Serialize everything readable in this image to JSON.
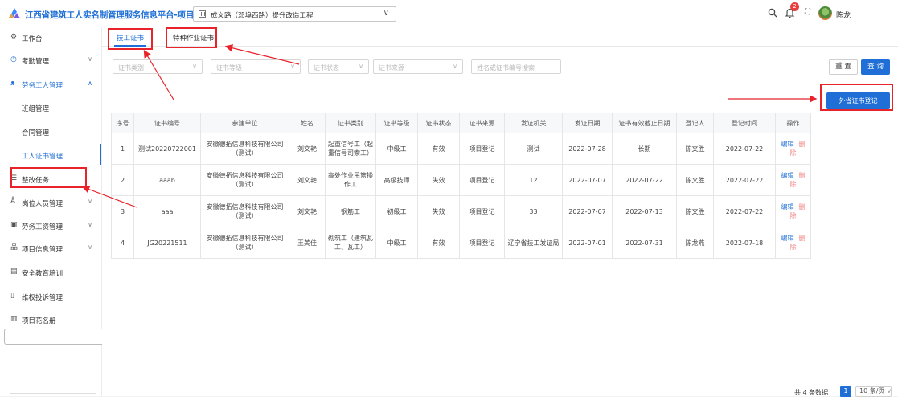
{
  "app": {
    "title": "江西省建筑工人实名制管理服务信息平台-项目端",
    "project": "成义路（邓埠西路）提升改造工程",
    "user": "陈龙",
    "notification_count": "2"
  },
  "sidebar": {
    "items": [
      {
        "label": "工作台",
        "icon": "home-icon"
      },
      {
        "label": "考勤管理",
        "icon": "clock-icon"
      },
      {
        "label": "劳务工人管理",
        "icon": "users-icon"
      },
      {
        "label": "班组管理"
      },
      {
        "label": "合同管理"
      },
      {
        "label": "工人证书管理"
      },
      {
        "label": "整改任务",
        "icon": "list-icon"
      },
      {
        "label": "岗位人员管理",
        "icon": "person-icon"
      },
      {
        "label": "劳务工资管理",
        "icon": "wallet-icon"
      },
      {
        "label": "项目信息管理",
        "icon": "building-icon"
      },
      {
        "label": "安全教育培训",
        "icon": "book-icon"
      },
      {
        "label": "维权投诉管理",
        "icon": "doc-icon"
      },
      {
        "label": "项目花名册",
        "icon": "roster-icon"
      }
    ]
  },
  "tabs": [
    "技工证书",
    "特种作业证书"
  ],
  "filters": {
    "category": "证书类别",
    "level": "证书等级",
    "status": "证书状态",
    "source": "证书来源",
    "search_placeholder": "姓名或证书编号搜索"
  },
  "buttons": {
    "reset": "重 置",
    "query": "查 询",
    "add": "外省证书登记"
  },
  "table": {
    "headers": [
      "序号",
      "证书编号",
      "参建单位",
      "姓名",
      "证书类别",
      "证书等级",
      "证书状态",
      "证书来源",
      "发证机关",
      "发证日期",
      "证书有效截止日期",
      "登记人",
      "登记时间",
      "操作"
    ],
    "edit_label": "编辑",
    "delete_label": "删除",
    "rows": [
      [
        "1",
        "测试20220722001",
        "安徽德拓信息科技有限公司（测试）",
        "刘文艳",
        "起重信号工（起重信号司索工）",
        "中级工",
        "有效",
        "项目登记",
        "测试",
        "2022-07-28",
        "长期",
        "陈文胜",
        "2022-07-22"
      ],
      [
        "2",
        "aaab",
        "安徽德拓信息科技有限公司（测试）",
        "刘文艳",
        "高处作业吊篮操作工",
        "高级技师",
        "失效",
        "项目登记",
        "12",
        "2022-07-07",
        "2022-07-22",
        "陈文胜",
        "2022-07-22"
      ],
      [
        "3",
        "aaa",
        "安徽德拓信息科技有限公司（测试）",
        "刘文艳",
        "钢筋工",
        "初级工",
        "失效",
        "项目登记",
        "33",
        "2022-07-07",
        "2022-07-13",
        "陈文胜",
        "2022-07-22"
      ],
      [
        "4",
        "JG20221511",
        "安徽德拓信息科技有限公司（测试）",
        "王美佳",
        "砌筑工（建筑瓦工、瓦工）",
        "中级工",
        "有效",
        "项目登记",
        "辽宁省技工发证局",
        "2022-07-01",
        "2022-07-31",
        "陈龙燕",
        "2022-07-18"
      ]
    ]
  },
  "pager": {
    "total": "共 4 条数据",
    "page": "1",
    "page_size": "10 条/页"
  },
  "colors": {
    "primary": "#1f6fd6",
    "annotation": "#e8232a",
    "danger": "#f08a8a"
  }
}
